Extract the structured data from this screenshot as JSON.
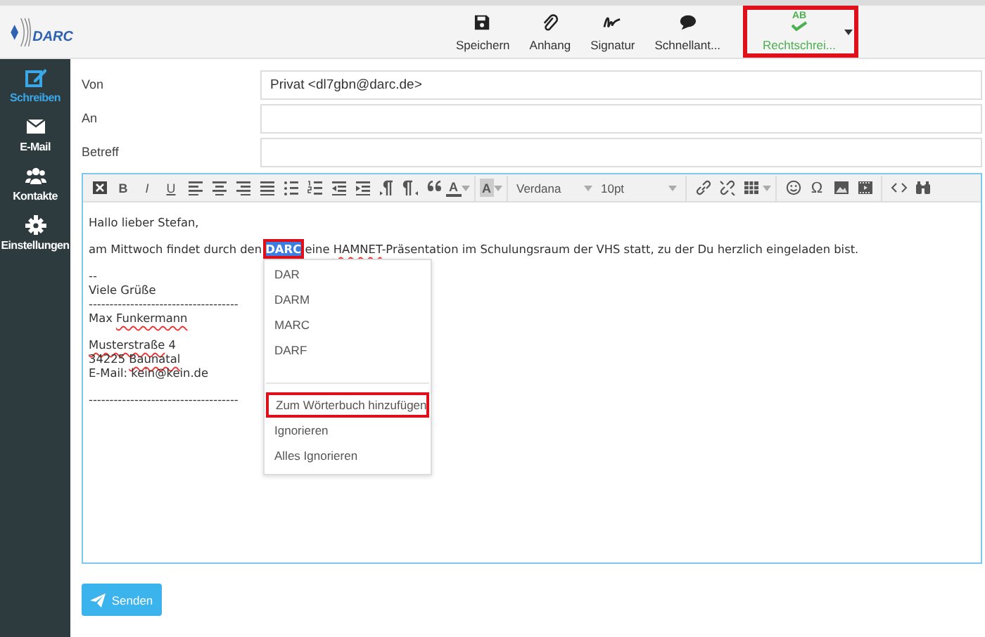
{
  "logo": {
    "text": "DARC"
  },
  "toolbar": [
    {
      "label": "Speichern",
      "active": false,
      "highlighted": false,
      "dropdown": false
    },
    {
      "label": "Anhang",
      "active": false,
      "highlighted": false,
      "dropdown": false
    },
    {
      "label": "Signatur",
      "active": false,
      "highlighted": false,
      "dropdown": false
    },
    {
      "label": "Schnellant...",
      "active": false,
      "highlighted": false,
      "dropdown": false
    },
    {
      "icon_text": "AB",
      "label": "Rechtschrei...",
      "active": true,
      "highlighted": true,
      "dropdown": true
    }
  ],
  "sidebar": {
    "items": [
      {
        "label": "Schreiben",
        "selected": true
      },
      {
        "label": "E-Mail",
        "selected": false
      },
      {
        "label": "Kontakte",
        "selected": false
      },
      {
        "label": "Einstellungen",
        "selected": false
      }
    ]
  },
  "form": {
    "fields": [
      {
        "label": "Von",
        "value": "Privat <dl7gbn@darc.de>"
      },
      {
        "label": "An"
      },
      {
        "label": "Betreff"
      }
    ]
  },
  "editor": {
    "toolbar": {
      "bold": "B",
      "italic": "I",
      "underline": "U",
      "text_color": "A",
      "background_color": "A",
      "font": "Verdana",
      "size": "10pt",
      "special_char": "Ω"
    },
    "paragraphs": [
      [
        [
          {
            "text": "Hallo lieber Stefan,",
            "kind": "plain"
          }
        ]
      ],
      [
        [
          {
            "text": "am Mittwoch findet durch den ",
            "kind": "plain"
          },
          {
            "text": "DARC",
            "kind": "selected",
            "highlighted": true
          },
          {
            "text": " eine ",
            "kind": "plain"
          },
          {
            "text": "HAMNET",
            "kind": "misspelled"
          },
          {
            "text": "-Präsentation im Schulungsraum der VHS statt, zu der Du herzlich eingeladen bist.",
            "kind": "plain"
          }
        ]
      ],
      [
        [
          {
            "text": "--",
            "kind": "plain"
          }
        ],
        [
          {
            "text": "Viele Grüße",
            "kind": "plain"
          }
        ],
        [
          {
            "text": "------------------------------------",
            "kind": "plain"
          }
        ],
        [
          {
            "text": "Max ",
            "kind": "plain"
          },
          {
            "text": "Funkermann",
            "kind": "misspelled"
          }
        ]
      ],
      [
        [
          {
            "text": "Musterstraße",
            "kind": "misspelled"
          },
          {
            "text": " 4",
            "kind": "plain"
          }
        ],
        [
          {
            "text": "34225 ",
            "kind": "plain"
          },
          {
            "text": "Baunatal",
            "kind": "misspelled"
          }
        ],
        [
          {
            "text": "E-Mail: kein@kein.de",
            "kind": "plain"
          }
        ]
      ],
      [
        [
          {
            "text": "------------------------------------",
            "kind": "plain"
          }
        ]
      ]
    ],
    "context_menu": {
      "suggestions": [
        "DAR",
        "DARM",
        "MARC",
        "DARF"
      ],
      "actions": [
        {
          "label": "Zum Wörterbuch hinzufügen",
          "highlighted": true
        },
        {
          "label": "Ignorieren",
          "highlighted": false
        },
        {
          "label": "Alles Ignorieren",
          "highlighted": false
        }
      ]
    }
  },
  "send_button": {
    "label": "Senden"
  }
}
